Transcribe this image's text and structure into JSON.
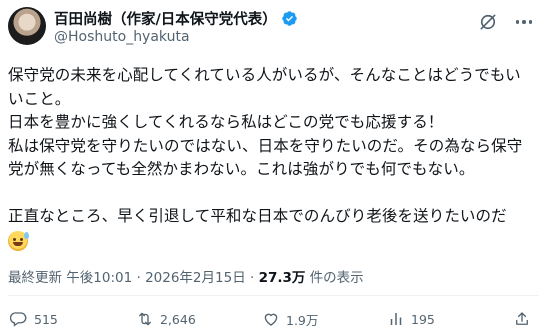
{
  "user": {
    "display_name": "百田尚樹（作家/日本保守党代表）",
    "handle": "@Hoshuto_hyakuta",
    "verified_icon": "verified-badge-icon",
    "verified_color": "#1d9bf0"
  },
  "post": {
    "lines": [
      "保守党の未来を心配してくれている人がいるが、そんなことはどうでもい",
      "いこと。",
      "日本を豊かに強くしてくれるなら私はどこの党でも応援する！",
      "私は保守党を守りたいのではない、日本を守りたいのだ。その為なら保守",
      "党が無くなっても全然かまわない。これは強がりでも何でもない。",
      "",
      "正直なところ、早く引退して平和な日本でのんびり老後を送りたいのだ"
    ],
    "emoji": "sweat-smile-emoji"
  },
  "meta": {
    "prefix": "最終更新 午後10:01 · 2026年2月15日 · ",
    "views": "27.3万",
    "views_suffix": " 件の表示"
  },
  "actions": {
    "replies": "515",
    "reposts": "2,646",
    "likes": "1.9万",
    "bookmarks": "195"
  },
  "colors": {
    "text": "#0f1419",
    "secondary": "#536471",
    "divider": "#eff3f4"
  }
}
